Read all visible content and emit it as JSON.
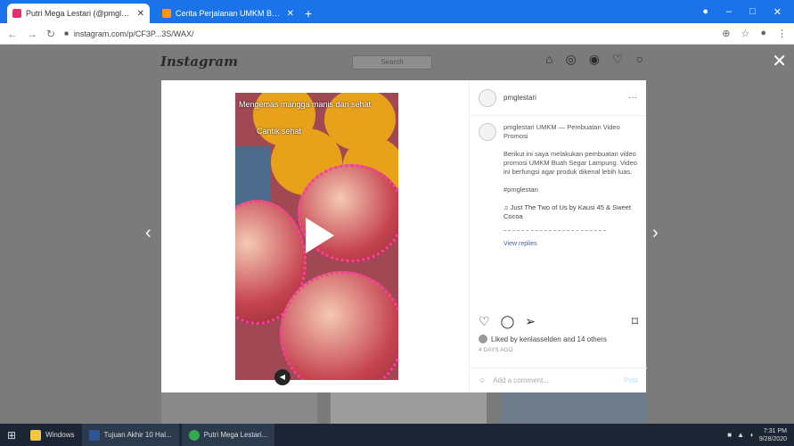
{
  "browser": {
    "tabs": [
      {
        "title": "Putri Mega Lestari (@pmglestari)",
        "active": true,
        "favicon_color": "#e1306c"
      },
      {
        "title": "Cerita Perjalanan UMKM Buah Segar",
        "active": false,
        "favicon_color": "#ff9800"
      }
    ],
    "new_tab": "+",
    "url": "instagram.com/p/CF3P...3S/WAX/",
    "window_controls": [
      "–",
      "□",
      "✕"
    ]
  },
  "instagram": {
    "logo": "Instagram",
    "search_placeholder": "Search",
    "post": {
      "video_text_1": "Mengemas mangga manis dan sehat",
      "video_text_2": "Cantik sehat",
      "username": "pmglestari",
      "caption_user": "pmglestari",
      "caption_text": "UMKM — Pembuatan Video Promosi",
      "paragraph": "Berikut ini saya melakukan pembuatan video promosi UMKM Buah Segar Lampung. Video ini berfungsi agar produk dikenal lebih luas.",
      "hashtag": "#pmglestari",
      "music": "Just The Two of Us by Kausi 45 & Sweet Cocoa",
      "replies": "View replies",
      "liked_by": "Liked by kenlasselden and 14 others",
      "time_ago": "4 DAYS AGO",
      "add_comment": "Add a comment...",
      "post_button": "Post"
    }
  },
  "taskbar": {
    "items": [
      "Windows",
      "Tujuan Akhir 10 Hal...",
      "Putri Mega Lestari..."
    ],
    "time": "7:31 PM",
    "date": "9/28/2020"
  }
}
